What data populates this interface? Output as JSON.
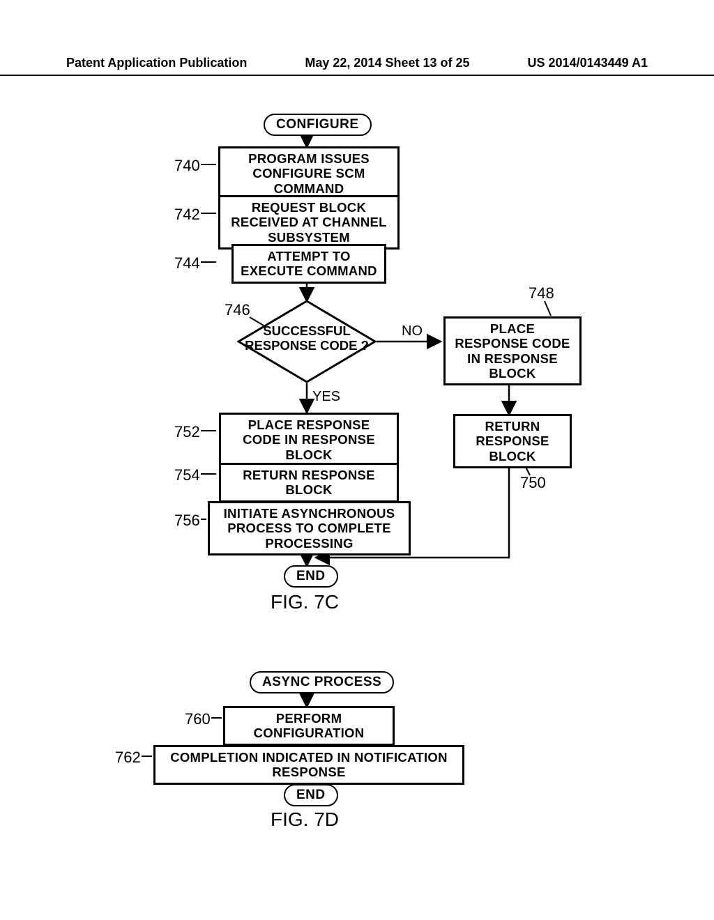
{
  "header": {
    "left": "Patent Application Publication",
    "center": "May 22, 2014  Sheet 13 of 25",
    "right": "US 2014/0143449 A1"
  },
  "fig7c": {
    "start": "CONFIGURE",
    "step740": "PROGRAM ISSUES CONFIGURE SCM COMMAND",
    "step742": "REQUEST BLOCK RECEIVED AT CHANNEL SUBSYSTEM",
    "step744": "ATTEMPT TO EXECUTE COMMAND",
    "decision746": "SUCCESSFUL RESPONSE CODE ?",
    "step748": "PLACE RESPONSE CODE IN RESPONSE BLOCK",
    "step750": "RETURN RESPONSE BLOCK",
    "step752": "PLACE RESPONSE CODE IN RESPONSE BLOCK",
    "step754": "RETURN RESPONSE BLOCK",
    "step756": "INITIATE ASYNCHRONOUS PROCESS TO COMPLETE PROCESSING",
    "end": "END",
    "labels": {
      "n740": "740",
      "n742": "742",
      "n744": "744",
      "n746": "746",
      "n748": "748",
      "n750": "750",
      "n752": "752",
      "n754": "754",
      "n756": "756",
      "yes": "YES",
      "no": "NO"
    },
    "caption": "FIG. 7C"
  },
  "fig7d": {
    "start": "ASYNC PROCESS",
    "step760": "PERFORM CONFIGURATION",
    "step762": "COMPLETION INDICATED IN NOTIFICATION RESPONSE",
    "end": "END",
    "labels": {
      "n760": "760",
      "n762": "762"
    },
    "caption": "FIG. 7D"
  }
}
